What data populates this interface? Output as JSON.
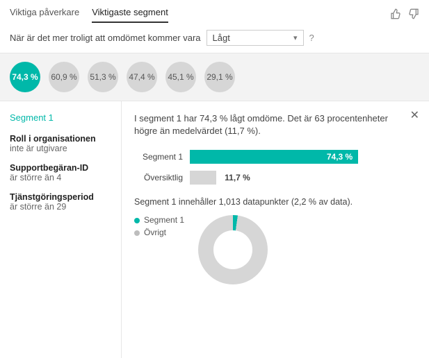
{
  "tabs": {
    "influencers": "Viktiga påverkare",
    "segments": "Viktigaste segment"
  },
  "prompt": {
    "text": "När är det mer troligt att omdömet kommer vara",
    "selected": "Lågt",
    "help": "?"
  },
  "bubbles": [
    "74,3 %",
    "60,9 %",
    "51,3 %",
    "47,4 %",
    "45,1 %",
    "29,1 %"
  ],
  "left": {
    "title": "Segment 1",
    "conds": [
      {
        "k": "Roll i organisationen",
        "v": "inte är utgivare"
      },
      {
        "k": "Supportbegäran-ID",
        "v": "är större än 4"
      },
      {
        "k": "Tjänstgöringsperiod",
        "v": "är större än 29"
      }
    ]
  },
  "right": {
    "summary": "I segment 1 har 74,3 % lågt omdöme. Det är 63 procentenheter högre än medelvärdet (11,7 %).",
    "bars": [
      {
        "label": "Segment 1",
        "value": "74,3 %",
        "pct": 74.3,
        "cls": "teal"
      },
      {
        "label": "Översiktlig",
        "value": "11,7 %",
        "pct": 11.7,
        "cls": "grey"
      }
    ],
    "datapoints": "Segment 1 innehåller 1,013 datapunkter (2,2 % av data).",
    "legend": {
      "a": "Segment 1",
      "b": "Övrigt"
    }
  },
  "chart_data": [
    {
      "type": "bar",
      "orientation": "horizontal",
      "categories": [
        "Segment 1",
        "Översiktlig"
      ],
      "values": [
        74.3,
        11.7
      ],
      "ylim": [
        0,
        100
      ],
      "unit": "%",
      "title": "",
      "colors": [
        "#00b8a9",
        "#d6d6d6"
      ]
    },
    {
      "type": "pie",
      "donut": true,
      "series": [
        {
          "name": "Segment 1",
          "value": 2.2,
          "color": "#00b8a9"
        },
        {
          "name": "Övrigt",
          "value": 97.8,
          "color": "#d6d6d6"
        }
      ],
      "unit": "%",
      "title": ""
    }
  ]
}
